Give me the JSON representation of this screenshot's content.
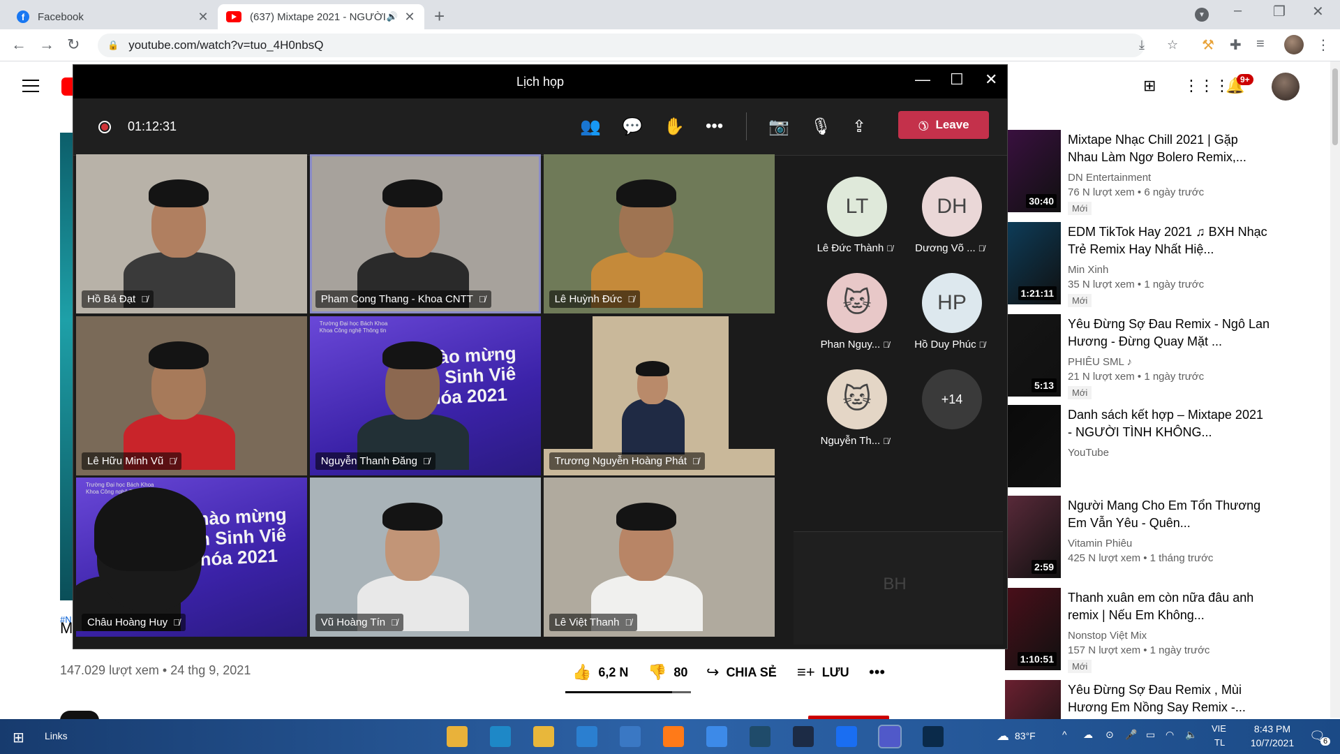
{
  "browser": {
    "tabs": [
      {
        "title": "Facebook",
        "active": false
      },
      {
        "title": "(637) Mixtape 2021 - NGƯỜI",
        "active": true
      }
    ],
    "url": "youtube.com/watch?v=tuo_4H0nbsQ"
  },
  "youtube": {
    "notif_count": "9+",
    "video": {
      "hashtag_fragment": "#N",
      "title_fragment": "M",
      "stats": "147.029 lượt xem • 24 thg 9, 2021",
      "likes": "6,2 N",
      "dislikes": "80",
      "share_label": "CHIA SẺ",
      "save_label": "LƯU",
      "like_ratio": 0.85
    },
    "recommendations": [
      {
        "title": "Mixtape Nhạc Chill 2021 | Gặp Nhau Làm Ngơ Bolero Remix,...",
        "channel": "DN Entertainment",
        "meta": "76 N lượt xem • 6 ngày trước",
        "badge": "Mới",
        "duration": "30:40",
        "thumb_color": "#3a1040"
      },
      {
        "title": "EDM TikTok Hay 2021 ♫ BXH Nhạc Trẻ Remix Hay Nhất Hiệ...",
        "channel": "Min Xinh",
        "meta": "35 N lượt xem • 1 ngày trước",
        "badge": "Mới",
        "duration": "1:21:11",
        "thumb_color": "#0d3d5a"
      },
      {
        "title": "Yêu Đừng Sợ Đau Remix - Ngô Lan Hương - Đừng Quay Mặt ...",
        "channel": "PHIÊU SML ♪",
        "meta": "21 N lượt xem • 1 ngày trước",
        "badge": "Mới",
        "duration": "5:13",
        "thumb_color": "#151515"
      },
      {
        "title": "Danh sách kết hợp – Mixtape 2021 - NGƯỜI TÌNH KHÔNG...",
        "channel": "YouTube",
        "meta": "",
        "badge": "",
        "duration": "",
        "thumb_color": "#0a0a0a"
      },
      {
        "title": "Người Mang Cho Em Tổn Thương Em Vẫn Yêu - Quên...",
        "channel": "Vitamin Phiêu",
        "meta": "425 N lượt xem • 1 tháng trước",
        "badge": "",
        "duration": "2:59",
        "thumb_color": "#5a2a3a"
      },
      {
        "title": "Thanh xuân em còn nữa đâu anh remix | Nếu Em Không...",
        "channel": "Nonstop Việt Mix",
        "meta": "157 N lượt xem • 1 ngày trước",
        "badge": "Mới",
        "duration": "1:10:51",
        "thumb_color": "#4a0f1a"
      },
      {
        "title": "Yêu Đừng Sợ Đau Remix , Mùi Hương Em Nồng Say Remix -...",
        "channel": "",
        "meta": "",
        "badge": "",
        "duration": "",
        "thumb_color": "#6a2030"
      }
    ]
  },
  "teams": {
    "window_title": "Lịch họp",
    "timer": "01:12:31",
    "leave_label": "Leave",
    "participants": [
      {
        "name": "Hồ Bá Đạt",
        "bg": "#b8b2a8",
        "skin": "#b07f60",
        "shirt": "#3a3a3a"
      },
      {
        "name": "Pham Cong Thang - Khoa CNTT",
        "bg": "#a7a29c",
        "skin": "#b68466",
        "shirt": "#2a2a2a"
      },
      {
        "name": "Lê Huỳnh Đức",
        "bg": "#6f7a58",
        "skin": "#9f7452",
        "shirt": "#c58a3a"
      },
      {
        "name": "Lê Hữu Minh Vũ",
        "bg": "#7a6a58",
        "skin": "#a77a5a",
        "shirt": "#c9242a"
      },
      {
        "name": "Nguyễn Thanh Đăng",
        "bg": "#4b2fb8",
        "skin": "#8c6850",
        "shirt": "#223036"
      },
      {
        "name": "Trương Nguyễn Hoàng Phát",
        "bg": "#c9b89a",
        "skin": "#b98a6a",
        "shirt": "#1f2a44"
      },
      {
        "name": "Châu Hoàng Huy",
        "bg": "#5a35c2",
        "skin": "#1a1a1a",
        "shirt": "#1a1a1a"
      },
      {
        "name": "Vũ Hoàng Tín",
        "bg": "#a9b3b8",
        "skin": "#c29577",
        "shirt": "#e8e8e8"
      },
      {
        "name": "Lê Việt Thanh",
        "bg": "#b0aa9e",
        "skin": "#b88566",
        "shirt": "#f0f0ee"
      }
    ],
    "banner_text": "hào mừng\nn Sinh Viê\nhóa 2021",
    "banner_small": "Trường Đại học Bách Khoa\nKhoa Công nghệ Thông tin",
    "roster": [
      {
        "initials": "LT",
        "name": "Lê Đức Thành",
        "color": "#dfe9da"
      },
      {
        "initials": "DH",
        "name": "Dương Võ ...",
        "color": "#ead7d7"
      },
      {
        "initials": "",
        "name": "Phan Nguy...",
        "color": "#e8c8c8",
        "avatar": "cat-pink-hat"
      },
      {
        "initials": "HP",
        "name": "Hồ Duy Phúc",
        "color": "#dde8ee"
      },
      {
        "initials": "",
        "name": "Nguyễn Th...",
        "color": "#e4d6c6",
        "avatar": "cat-blanket"
      },
      {
        "initials": "+14",
        "name": "",
        "color": "#3a3a3a"
      }
    ],
    "bottom_participant": {
      "initials": "BH",
      "color": "#dfe3d6"
    }
  },
  "taskbar": {
    "links_label": "Links",
    "temperature": "83°F",
    "lang_top": "VIE",
    "lang_bottom": "TL",
    "time": "8:43 PM",
    "date": "10/7/2021",
    "notif_count": "6",
    "apps": [
      "chrome-icon",
      "edge-icon",
      "file-explorer-icon",
      "vscode-icon",
      "mail-icon",
      "firefox-icon",
      "dropbox-icon",
      "notes-icon",
      "lightroom-icon",
      "zalo-icon",
      "teams-icon",
      "photoshop-icon"
    ]
  }
}
